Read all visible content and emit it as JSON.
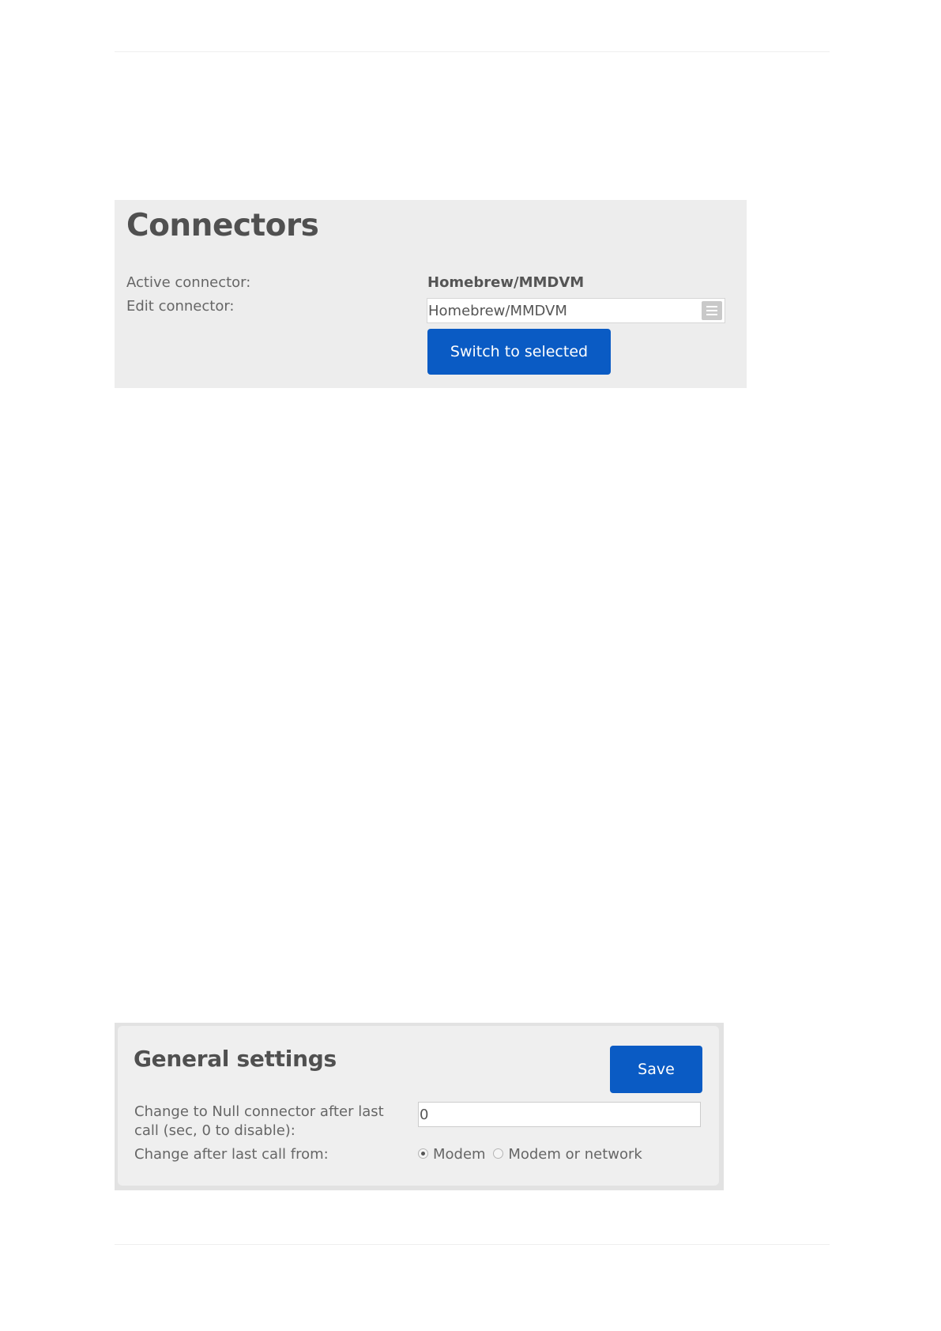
{
  "connectors": {
    "title": "Connectors",
    "active_label": "Active connector:",
    "active_value": "Homebrew/MMDVM",
    "edit_label": "Edit connector:",
    "edit_selected": "Homebrew/MMDVM",
    "edit_icon": "list-icon",
    "switch_button": "Switch to selected"
  },
  "general": {
    "title": "General settings",
    "save_button": "Save",
    "null_label": "Change to Null connector after last call (sec, 0 to disable):",
    "null_value": "0",
    "change_from_label": "Change after last call from:",
    "options": [
      {
        "label": "Modem",
        "checked": true
      },
      {
        "label": "Modem or network",
        "checked": false
      }
    ]
  },
  "colors": {
    "button": "#0a5bc4",
    "panel": "#ededed"
  }
}
